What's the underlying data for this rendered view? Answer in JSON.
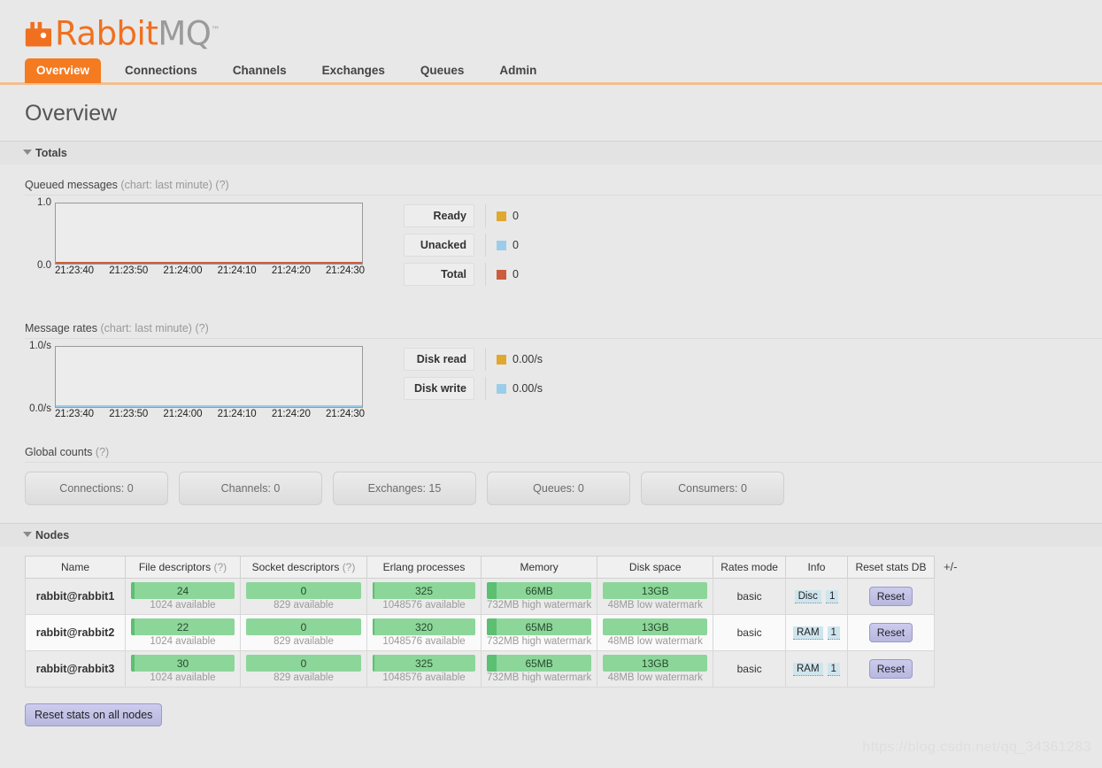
{
  "brand": {
    "name_rabbit": "Rabbit",
    "name_mq": "MQ",
    "tm": "™"
  },
  "nav": {
    "tabs": [
      {
        "label": "Overview",
        "active": true
      },
      {
        "label": "Connections",
        "active": false
      },
      {
        "label": "Channels",
        "active": false
      },
      {
        "label": "Exchanges",
        "active": false
      },
      {
        "label": "Queues",
        "active": false
      },
      {
        "label": "Admin",
        "active": false
      }
    ]
  },
  "page": {
    "title": "Overview"
  },
  "sections": {
    "totals": {
      "label": "Totals",
      "expanded": true
    },
    "nodes": {
      "label": "Nodes",
      "expanded": true
    }
  },
  "queued_messages": {
    "label": "Queued messages",
    "hint": "(chart: last minute)",
    "help": "(?)"
  },
  "message_rates": {
    "label": "Message rates",
    "hint": "(chart: last minute)",
    "help": "(?)"
  },
  "global_counts": {
    "label": "Global counts",
    "help": "(?)",
    "items": [
      {
        "label": "Connections: 0"
      },
      {
        "label": "Channels: 0"
      },
      {
        "label": "Exchanges: 15"
      },
      {
        "label": "Queues: 0"
      },
      {
        "label": "Consumers: 0"
      }
    ]
  },
  "chart_data": [
    {
      "type": "line",
      "title": "Queued messages",
      "subtitle": "(chart: last minute)",
      "xlabel": "",
      "ylabel": "",
      "ylim": [
        0.0,
        1.0
      ],
      "ytick_labels": [
        "1.0",
        "0.0"
      ],
      "x": [
        "21:23:40",
        "21:23:50",
        "21:24:00",
        "21:24:10",
        "21:24:20",
        "21:24:30"
      ],
      "grid": false,
      "legend_position": "right",
      "series": [
        {
          "name": "Ready",
          "color": "#e0a82e",
          "value_label": "0",
          "values": [
            0,
            0,
            0,
            0,
            0,
            0
          ]
        },
        {
          "name": "Unacked",
          "color": "#9bcdea",
          "value_label": "0",
          "values": [
            0,
            0,
            0,
            0,
            0,
            0
          ]
        },
        {
          "name": "Total",
          "color": "#cc5c3e",
          "value_label": "0",
          "values": [
            0,
            0,
            0,
            0,
            0,
            0
          ]
        }
      ]
    },
    {
      "type": "line",
      "title": "Message rates",
      "subtitle": "(chart: last minute)",
      "xlabel": "",
      "ylabel": "",
      "ylim": [
        0.0,
        1.0
      ],
      "ytick_labels": [
        "1.0/s",
        "0.0/s"
      ],
      "x": [
        "21:23:40",
        "21:23:50",
        "21:24:00",
        "21:24:10",
        "21:24:20",
        "21:24:30"
      ],
      "grid": false,
      "legend_position": "right",
      "series": [
        {
          "name": "Disk read",
          "color": "#e0a82e",
          "value_label": "0.00/s",
          "values": [
            0,
            0,
            0,
            0,
            0,
            0
          ]
        },
        {
          "name": "Disk write",
          "color": "#9bcdea",
          "value_label": "0.00/s",
          "values": [
            0,
            0,
            0,
            0,
            0,
            0
          ]
        }
      ]
    }
  ],
  "nodes_table": {
    "columns": [
      {
        "label": "Name",
        "help": ""
      },
      {
        "label": "File descriptors",
        "help": "(?)"
      },
      {
        "label": "Socket descriptors",
        "help": "(?)"
      },
      {
        "label": "Erlang processes",
        "help": ""
      },
      {
        "label": "Memory",
        "help": ""
      },
      {
        "label": "Disk space",
        "help": ""
      },
      {
        "label": "Rates mode",
        "help": ""
      },
      {
        "label": "Info",
        "help": ""
      },
      {
        "label": "Reset stats DB",
        "help": ""
      }
    ],
    "plus_minus": "+/-",
    "rows": [
      {
        "name": "rabbit@rabbit1",
        "file_descriptors": {
          "value": "24",
          "sub": "1024 available",
          "fill_pct": 3
        },
        "socket_descriptors": {
          "value": "0",
          "sub": "829 available",
          "fill_pct": 0
        },
        "erlang_processes": {
          "value": "325",
          "sub": "1048576 available",
          "fill_pct": 2
        },
        "memory": {
          "value": "66MB",
          "sub": "732MB high watermark",
          "fill_pct": 9
        },
        "disk_space": {
          "value": "13GB",
          "sub": "48MB low watermark",
          "fill_pct": 0
        },
        "rates_mode": "basic",
        "info": [
          "Disc",
          "1"
        ],
        "reset_label": "Reset"
      },
      {
        "name": "rabbit@rabbit2",
        "file_descriptors": {
          "value": "22",
          "sub": "1024 available",
          "fill_pct": 3
        },
        "socket_descriptors": {
          "value": "0",
          "sub": "829 available",
          "fill_pct": 0
        },
        "erlang_processes": {
          "value": "320",
          "sub": "1048576 available",
          "fill_pct": 2
        },
        "memory": {
          "value": "65MB",
          "sub": "732MB high watermark",
          "fill_pct": 9
        },
        "disk_space": {
          "value": "13GB",
          "sub": "48MB low watermark",
          "fill_pct": 0
        },
        "rates_mode": "basic",
        "info": [
          "RAM",
          "1"
        ],
        "reset_label": "Reset"
      },
      {
        "name": "rabbit@rabbit3",
        "file_descriptors": {
          "value": "30",
          "sub": "1024 available",
          "fill_pct": 3
        },
        "socket_descriptors": {
          "value": "0",
          "sub": "829 available",
          "fill_pct": 0
        },
        "erlang_processes": {
          "value": "325",
          "sub": "1048576 available",
          "fill_pct": 2
        },
        "memory": {
          "value": "65MB",
          "sub": "732MB high watermark",
          "fill_pct": 9
        },
        "disk_space": {
          "value": "13GB",
          "sub": "48MB low watermark",
          "fill_pct": 0
        },
        "rates_mode": "basic",
        "info": [
          "RAM",
          "1"
        ],
        "reset_label": "Reset"
      }
    ]
  },
  "footer": {
    "reset_all_label": "Reset stats on all nodes"
  },
  "watermark": {
    "text": "https://blog.csdn.net/qq_34361283"
  },
  "colors": {
    "brand_orange": "#f47b20",
    "ready": "#e0a82e",
    "unacked": "#9bcdea",
    "total": "#cc5c3e",
    "bar_green": "#8cd69a",
    "bar_green_dark": "#5cbf72"
  }
}
